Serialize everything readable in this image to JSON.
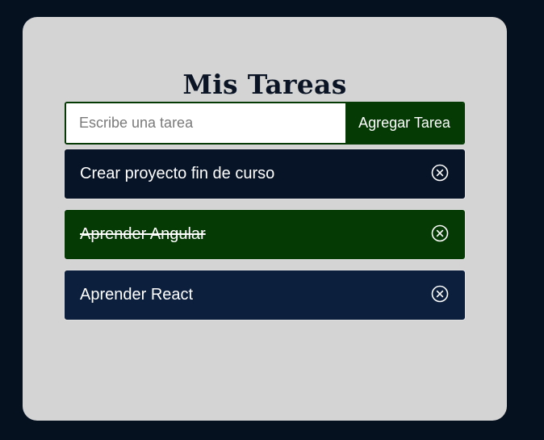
{
  "app": {
    "title": "Mis Tareas"
  },
  "form": {
    "placeholder": "Escribe una tarea",
    "value": "",
    "button_label": "Agregar Tarea"
  },
  "tasks": [
    {
      "text": "Crear proyecto fin de curso",
      "completed": false,
      "color": "#071427",
      "icon": "circle-x-icon"
    },
    {
      "text": "Aprender Angular",
      "completed": true,
      "color": "#053a05",
      "icon": "circle-x-icon"
    },
    {
      "text": "Aprender React",
      "completed": false,
      "color": "#0c203e",
      "icon": "circle-x-icon"
    }
  ],
  "colors": {
    "background": "#061120",
    "card": "#d4d4d4",
    "accent": "#053a05"
  }
}
